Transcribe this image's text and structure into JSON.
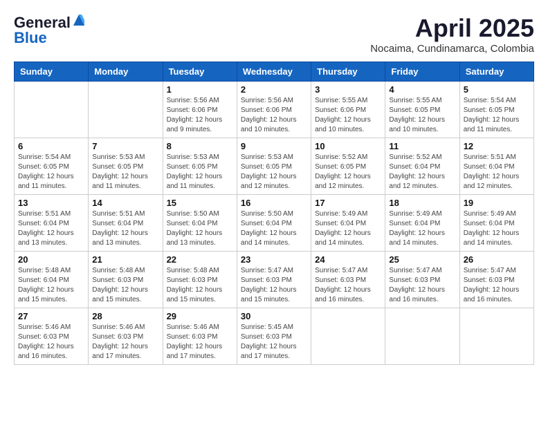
{
  "header": {
    "logo_general": "General",
    "logo_blue": "Blue",
    "month_year": "April 2025",
    "location": "Nocaima, Cundinamarca, Colombia"
  },
  "weekdays": [
    "Sunday",
    "Monday",
    "Tuesday",
    "Wednesday",
    "Thursday",
    "Friday",
    "Saturday"
  ],
  "weeks": [
    [
      {
        "day": "",
        "info": ""
      },
      {
        "day": "",
        "info": ""
      },
      {
        "day": "1",
        "info": "Sunrise: 5:56 AM\nSunset: 6:06 PM\nDaylight: 12 hours and 9 minutes."
      },
      {
        "day": "2",
        "info": "Sunrise: 5:56 AM\nSunset: 6:06 PM\nDaylight: 12 hours and 10 minutes."
      },
      {
        "day": "3",
        "info": "Sunrise: 5:55 AM\nSunset: 6:06 PM\nDaylight: 12 hours and 10 minutes."
      },
      {
        "day": "4",
        "info": "Sunrise: 5:55 AM\nSunset: 6:05 PM\nDaylight: 12 hours and 10 minutes."
      },
      {
        "day": "5",
        "info": "Sunrise: 5:54 AM\nSunset: 6:05 PM\nDaylight: 12 hours and 11 minutes."
      }
    ],
    [
      {
        "day": "6",
        "info": "Sunrise: 5:54 AM\nSunset: 6:05 PM\nDaylight: 12 hours and 11 minutes."
      },
      {
        "day": "7",
        "info": "Sunrise: 5:53 AM\nSunset: 6:05 PM\nDaylight: 12 hours and 11 minutes."
      },
      {
        "day": "8",
        "info": "Sunrise: 5:53 AM\nSunset: 6:05 PM\nDaylight: 12 hours and 11 minutes."
      },
      {
        "day": "9",
        "info": "Sunrise: 5:53 AM\nSunset: 6:05 PM\nDaylight: 12 hours and 12 minutes."
      },
      {
        "day": "10",
        "info": "Sunrise: 5:52 AM\nSunset: 6:05 PM\nDaylight: 12 hours and 12 minutes."
      },
      {
        "day": "11",
        "info": "Sunrise: 5:52 AM\nSunset: 6:04 PM\nDaylight: 12 hours and 12 minutes."
      },
      {
        "day": "12",
        "info": "Sunrise: 5:51 AM\nSunset: 6:04 PM\nDaylight: 12 hours and 12 minutes."
      }
    ],
    [
      {
        "day": "13",
        "info": "Sunrise: 5:51 AM\nSunset: 6:04 PM\nDaylight: 12 hours and 13 minutes."
      },
      {
        "day": "14",
        "info": "Sunrise: 5:51 AM\nSunset: 6:04 PM\nDaylight: 12 hours and 13 minutes."
      },
      {
        "day": "15",
        "info": "Sunrise: 5:50 AM\nSunset: 6:04 PM\nDaylight: 12 hours and 13 minutes."
      },
      {
        "day": "16",
        "info": "Sunrise: 5:50 AM\nSunset: 6:04 PM\nDaylight: 12 hours and 14 minutes."
      },
      {
        "day": "17",
        "info": "Sunrise: 5:49 AM\nSunset: 6:04 PM\nDaylight: 12 hours and 14 minutes."
      },
      {
        "day": "18",
        "info": "Sunrise: 5:49 AM\nSunset: 6:04 PM\nDaylight: 12 hours and 14 minutes."
      },
      {
        "day": "19",
        "info": "Sunrise: 5:49 AM\nSunset: 6:04 PM\nDaylight: 12 hours and 14 minutes."
      }
    ],
    [
      {
        "day": "20",
        "info": "Sunrise: 5:48 AM\nSunset: 6:04 PM\nDaylight: 12 hours and 15 minutes."
      },
      {
        "day": "21",
        "info": "Sunrise: 5:48 AM\nSunset: 6:03 PM\nDaylight: 12 hours and 15 minutes."
      },
      {
        "day": "22",
        "info": "Sunrise: 5:48 AM\nSunset: 6:03 PM\nDaylight: 12 hours and 15 minutes."
      },
      {
        "day": "23",
        "info": "Sunrise: 5:47 AM\nSunset: 6:03 PM\nDaylight: 12 hours and 15 minutes."
      },
      {
        "day": "24",
        "info": "Sunrise: 5:47 AM\nSunset: 6:03 PM\nDaylight: 12 hours and 16 minutes."
      },
      {
        "day": "25",
        "info": "Sunrise: 5:47 AM\nSunset: 6:03 PM\nDaylight: 12 hours and 16 minutes."
      },
      {
        "day": "26",
        "info": "Sunrise: 5:47 AM\nSunset: 6:03 PM\nDaylight: 12 hours and 16 minutes."
      }
    ],
    [
      {
        "day": "27",
        "info": "Sunrise: 5:46 AM\nSunset: 6:03 PM\nDaylight: 12 hours and 16 minutes."
      },
      {
        "day": "28",
        "info": "Sunrise: 5:46 AM\nSunset: 6:03 PM\nDaylight: 12 hours and 17 minutes."
      },
      {
        "day": "29",
        "info": "Sunrise: 5:46 AM\nSunset: 6:03 PM\nDaylight: 12 hours and 17 minutes."
      },
      {
        "day": "30",
        "info": "Sunrise: 5:45 AM\nSunset: 6:03 PM\nDaylight: 12 hours and 17 minutes."
      },
      {
        "day": "",
        "info": ""
      },
      {
        "day": "",
        "info": ""
      },
      {
        "day": "",
        "info": ""
      }
    ]
  ]
}
